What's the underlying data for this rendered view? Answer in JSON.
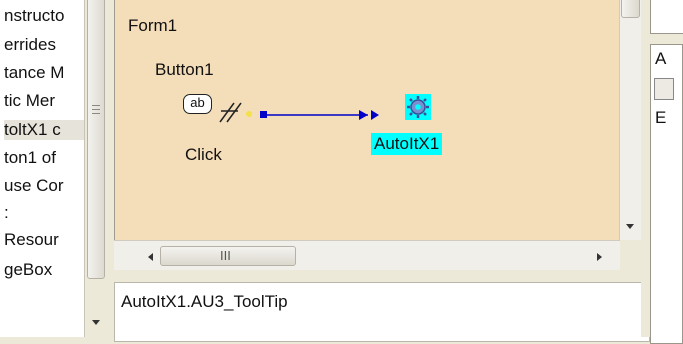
{
  "object_tree": {
    "items": [
      "nstructo",
      "errides",
      "tance M",
      "tic Mer",
      "toltX1 c",
      "ton1 of",
      "use Cor",
      ":",
      "Resour",
      "geBox"
    ]
  },
  "designer": {
    "form_title": "Form1",
    "event_source": {
      "name": "Button1",
      "icon_text": "ab",
      "event": "Click"
    },
    "event_target": {
      "name": "AutoItX1"
    },
    "hscroll_grip": "III"
  },
  "editor": {
    "text": "AutoItX1.AU3_ToolTip"
  },
  "right_panel": {
    "letter_a": "A",
    "letter_e": "E"
  },
  "colors": {
    "canvas": "#f4deb9",
    "selection": "#00ffff",
    "arrow": "#0000c8"
  }
}
